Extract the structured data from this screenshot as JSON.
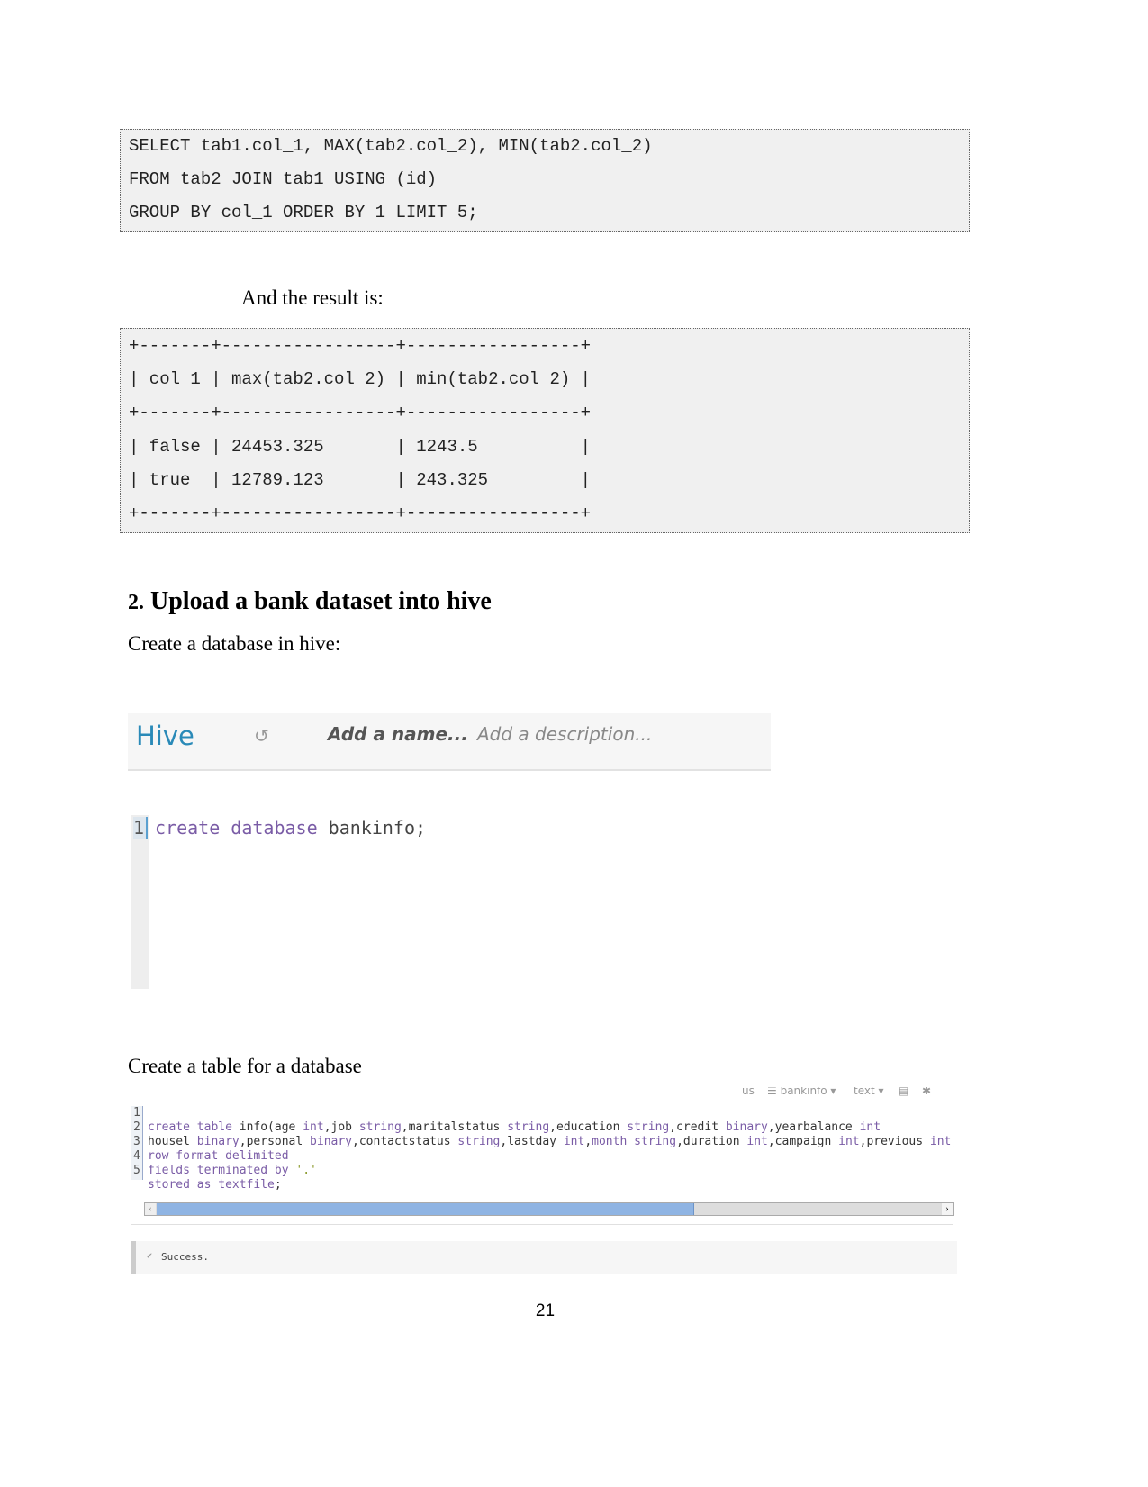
{
  "query_code": [
    "SELECT tab1.col_1, MAX(tab2.col_2), MIN(tab2.col_2)",
    "FROM tab2 JOIN tab1 USING (id)",
    "GROUP BY col_1 ORDER BY 1 LIMIT 5;"
  ],
  "result_intro": "And the result is:",
  "result_lines": [
    "+-------+-----------------+-----------------+",
    "| col_1 | max(tab2.col_2) | min(tab2.col_2) |",
    "+-------+-----------------+-----------------+",
    "| false | 24453.325       | 1243.5          |",
    "| true  | 12789.123       | 243.325         |",
    "+-------+-----------------+-----------------+"
  ],
  "section": {
    "number": "2.",
    "title": "Upload a bank dataset into hive"
  },
  "para_create_db": "Create a database in hive:",
  "hive_header": {
    "app": "Hive",
    "history_icon": "history-icon",
    "name_placeholder": "Add a name...",
    "description_placeholder": "Add a description..."
  },
  "editor1": {
    "line_no": "1",
    "kw": "create database",
    "rest": " bankinfo;"
  },
  "para_create_table": "Create a table for a database",
  "editor2": {
    "toolbar": {
      "cut": "us",
      "database": "bankinfo",
      "type": "text"
    },
    "line_numbers": [
      "1",
      "2",
      "3",
      "4",
      "5"
    ],
    "status": "Success."
  },
  "page_number": "21",
  "colors": {
    "keyword": "#7a5ca6",
    "hive_blue": "#2a8ab8",
    "scroll_blue": "#8fb4e3"
  }
}
